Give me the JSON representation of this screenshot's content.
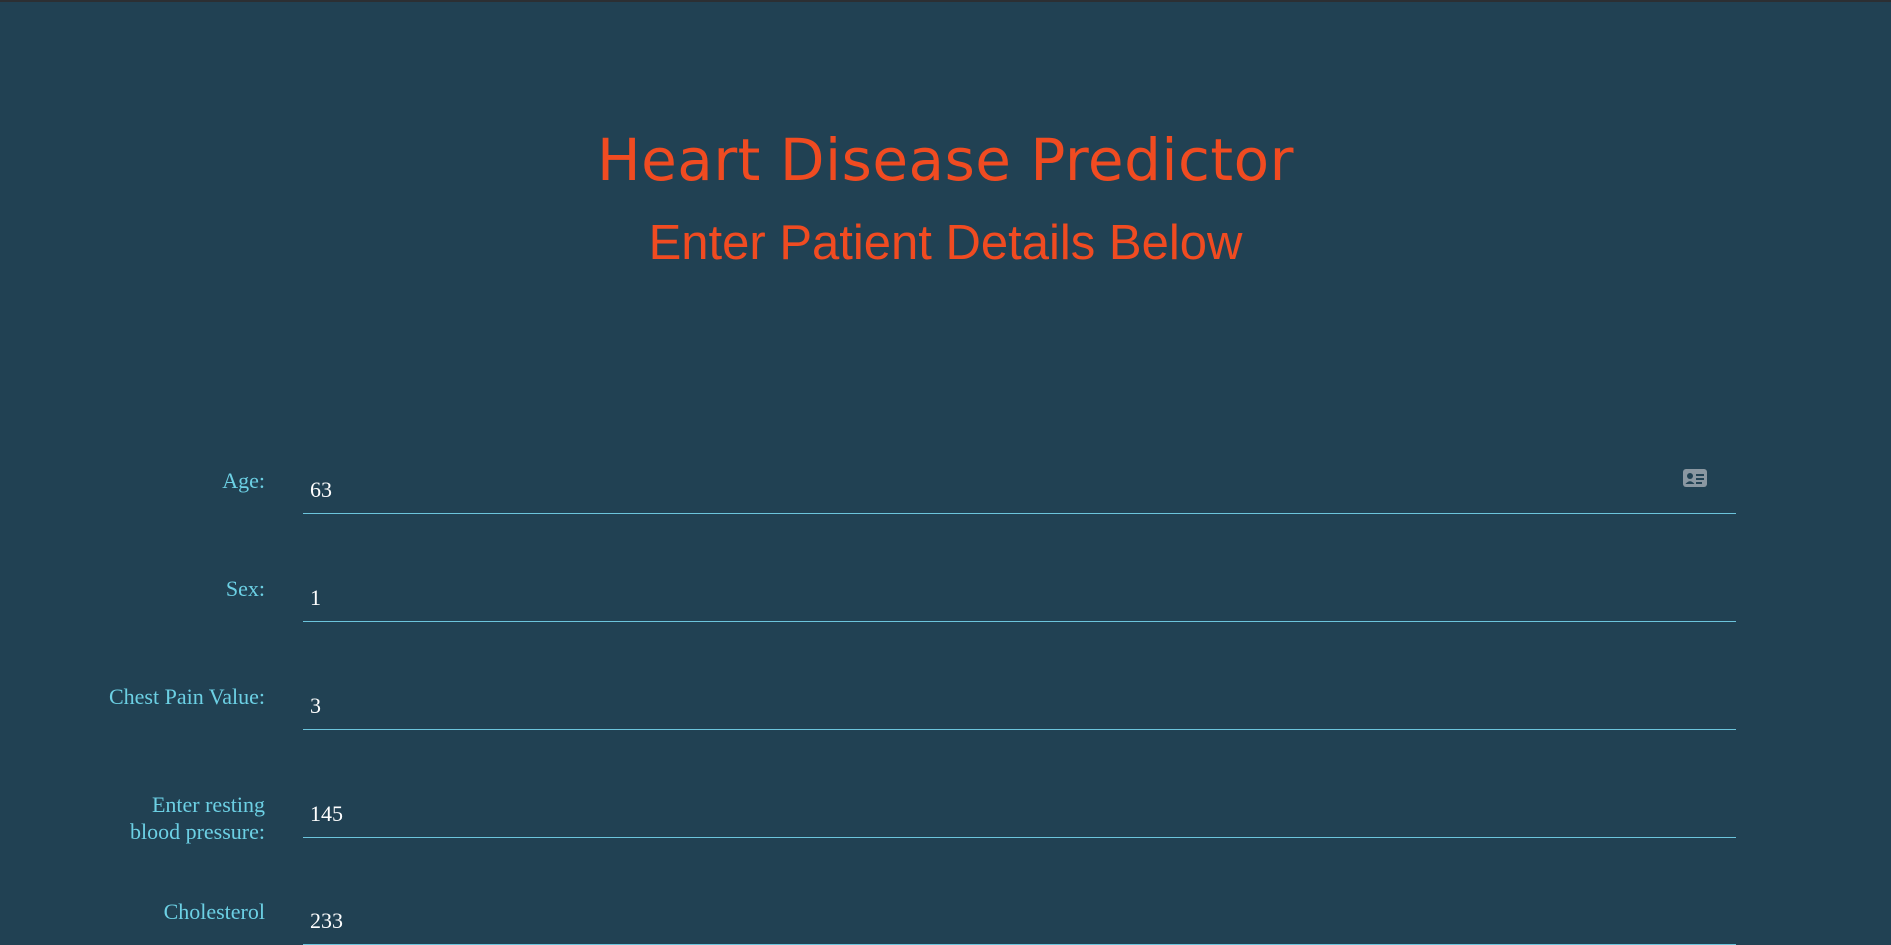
{
  "header": {
    "title": "Heart Disease Predictor",
    "subtitle": "Enter Patient Details Below"
  },
  "form": {
    "fields": [
      {
        "label": "Age:",
        "value": "63"
      },
      {
        "label": "Sex:",
        "value": "1"
      },
      {
        "label": "Chest Pain Value:",
        "value": "3"
      },
      {
        "label": "Enter resting blood pressure:",
        "value": "145"
      },
      {
        "label": "Cholesterol",
        "value": "233"
      }
    ]
  },
  "icons": {
    "autofill": "contact-card-icon"
  },
  "colors": {
    "background": "#214153",
    "accent": "#f04b21",
    "label": "#6cd0e4",
    "underline": "#6cc4dc",
    "value": "#ffffff"
  }
}
